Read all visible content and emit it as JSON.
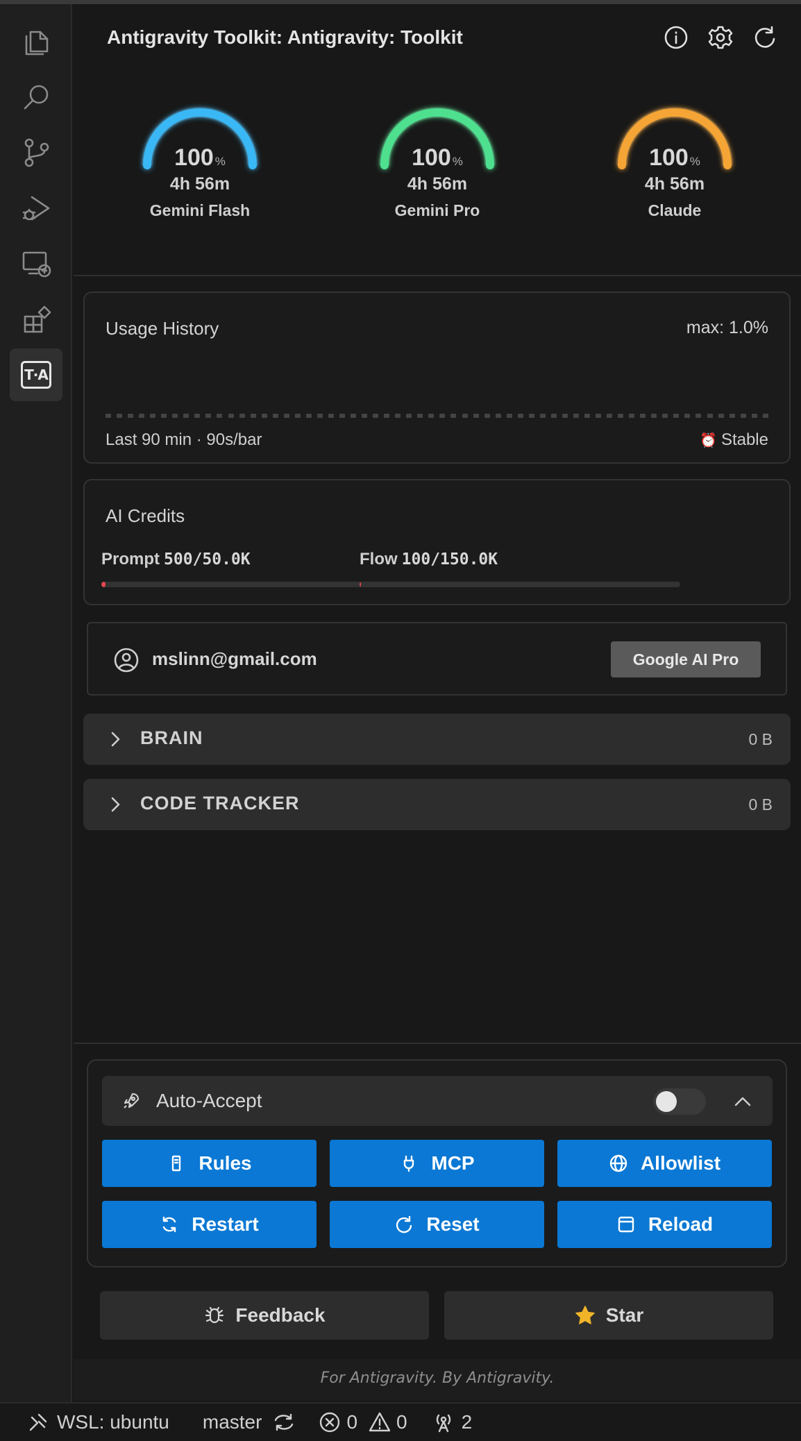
{
  "header": {
    "title": "Antigravity Toolkit: Antigravity: Toolkit",
    "icons": [
      "info-icon",
      "gear-icon",
      "refresh-icon"
    ]
  },
  "gauges": [
    {
      "pct": "100",
      "unit": "%",
      "time": "4h 56m",
      "name": "Gemini Flash",
      "color": "#3ab7f5",
      "level": 1.0
    },
    {
      "pct": "100",
      "unit": "%",
      "time": "4h 56m",
      "name": "Gemini Pro",
      "color": "#4ee08f",
      "level": 1.0
    },
    {
      "pct": "100",
      "unit": "%",
      "time": "4h 56m",
      "name": "Claude",
      "color": "#f5a535",
      "level": 1.0
    }
  ],
  "usage": {
    "title": "Usage History",
    "max": "max: 1.0%",
    "footer": "Last 90 min · 90s/bar",
    "status": "Stable",
    "status_icon": "alarm-clock-icon"
  },
  "credits": {
    "title": "AI Credits",
    "prompt": {
      "label": "Prompt",
      "value": "500/50.0K",
      "fraction": 0.01
    },
    "flow": {
      "label": "Flow",
      "value": "100/150.0K",
      "fraction": 0.0007
    }
  },
  "account": {
    "email": "mslinn@gmail.com",
    "plan": "Google AI Pro"
  },
  "sections": [
    {
      "label": "BRAIN",
      "size": "0 B"
    },
    {
      "label": "CODE TRACKER",
      "size": "0 B"
    }
  ],
  "tools": {
    "auto_accept_label": "Auto-Accept",
    "auto_accept_on": false,
    "buttons": [
      {
        "label": "Rules",
        "icon": "file-icon"
      },
      {
        "label": "MCP",
        "icon": "plug-icon"
      },
      {
        "label": "Allowlist",
        "icon": "globe-icon"
      },
      {
        "label": "Restart",
        "icon": "restart-icon"
      },
      {
        "label": "Reset",
        "icon": "reset-icon"
      },
      {
        "label": "Reload",
        "icon": "window-icon"
      }
    ]
  },
  "bottom": {
    "feedback": "Feedback",
    "star": "Star"
  },
  "footer_note": "For Antigravity. By Antigravity.",
  "status_bar": {
    "remote": "WSL: ubuntu",
    "branch": "master",
    "errors": "0",
    "warnings": "0",
    "ports": "2"
  },
  "colors": {
    "accent_button": "#0a78d4",
    "credit_fill": "#e5484d",
    "star": "#f0b429"
  }
}
